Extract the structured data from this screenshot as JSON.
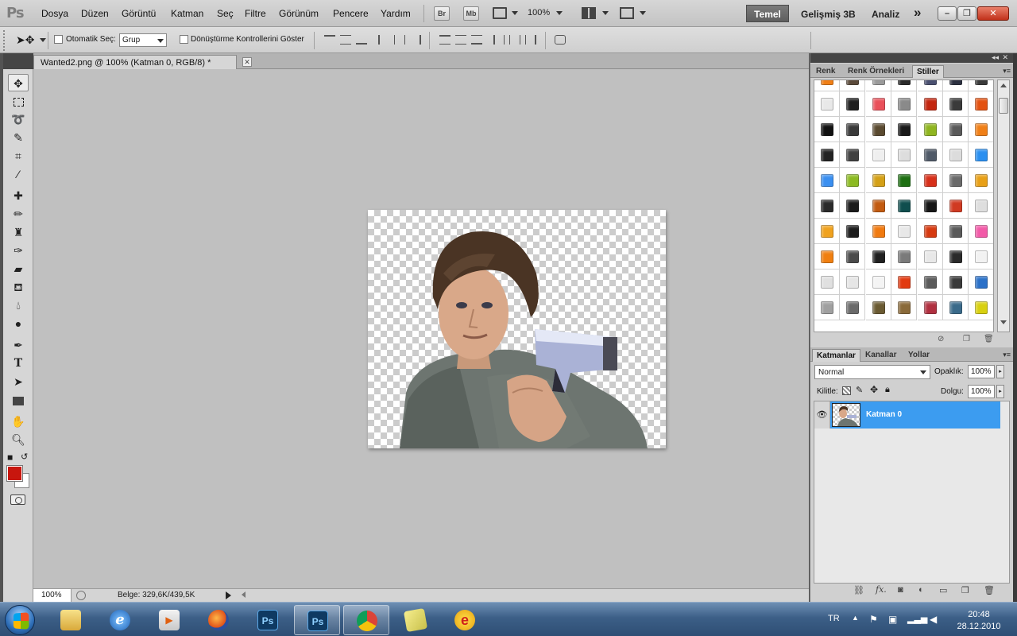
{
  "menubar": {
    "items": [
      "Dosya",
      "Düzen",
      "Görüntü",
      "Katman",
      "Seç",
      "Filtre",
      "Görünüm",
      "Pencere",
      "Yardım"
    ],
    "bridge_label": "Br",
    "minibridge_label": "Mb",
    "zoom": "100%",
    "workspace_active": "Temel",
    "workspace_items": [
      "Gelişmiş 3B",
      "Analiz"
    ],
    "more_symbol": "»"
  },
  "options": {
    "auto_select_label": "Otomatik Seç:",
    "auto_select_value": "Grup",
    "transform_label": "Dönüştürme Kontrollerini Göster"
  },
  "document": {
    "tab_title": "Wanted2.png @ 100% (Katman 0, RGB/8) *",
    "zoom": "100%",
    "info": "Belge: 329,6K/439,5K"
  },
  "styles_panel": {
    "tabs": [
      "Renk",
      "Renk Örnekleri",
      "Stiller"
    ],
    "active_tab": "Stiller",
    "swatches": [
      [
        "#f07f17",
        "#5b4a3a",
        "#9a9a9a",
        "#2a2a2a",
        "#4a5070",
        "#2c3040",
        "#3a3a3a"
      ],
      [
        "#e8e8e8",
        "#1f1f1f",
        "#e9505a",
        "#8a8a8a",
        "#c3260f",
        "#3a3a3a",
        "#e35211"
      ],
      [
        "#111111",
        "#3a3a3a",
        "#5a4a30",
        "#1a1a1a",
        "#8fb520",
        "#5a5a5a",
        "#f07f17"
      ],
      [
        "#222222",
        "#3f3f3f",
        "#efefef",
        "#dddddd",
        "#505a68",
        "#dcdcdc",
        "#2a8ff0"
      ],
      [
        "#3a8ff0",
        "#8cba22",
        "#d4a017",
        "#1e6f12",
        "#d7301a",
        "#6a6a6a",
        "#e8a017"
      ],
      [
        "#2a2a2a",
        "#1a1a1a",
        "#c25a10",
        "#0f4e4e",
        "#161616",
        "#d03a22",
        "#dedede"
      ],
      [
        "#f0a21e",
        "#1c1c1c",
        "#f07a10",
        "#e8e8e8",
        "#d63a10",
        "#5a5a5a",
        "#f25aa8"
      ],
      [
        "#f07f10",
        "#4a4a4a",
        "#202020",
        "#7a7a7a",
        "#e8e8e8",
        "#2a2a2a",
        "#f2f2f2"
      ],
      [
        "#e0e0e0",
        "#e6e6e6",
        "#f4f4f4",
        "#e23a10",
        "#5a5a5a",
        "#3a3a3a",
        "#2a70c8"
      ],
      [
        "#a0a0a0",
        "#6a6a6a",
        "#6a5a32",
        "#8a6a3a",
        "#b03040",
        "#3a6a8a",
        "#d8d010"
      ]
    ]
  },
  "layers_panel": {
    "tabs": [
      "Katmanlar",
      "Kanallar",
      "Yollar"
    ],
    "active_tab": "Katmanlar",
    "blend_mode": "Normal",
    "opacity_label": "Opaklık:",
    "opacity_value": "100%",
    "lock_label": "Kilitle:",
    "fill_label": "Dolgu:",
    "fill_value": "100%",
    "layers": [
      {
        "name": "Katman 0",
        "visible": true,
        "selected": true
      }
    ]
  },
  "taskbar": {
    "apps": [
      {
        "name": "explorer",
        "label": ""
      },
      {
        "name": "internet-explorer",
        "label": "e"
      },
      {
        "name": "media-player",
        "label": "▶"
      },
      {
        "name": "firefox",
        "label": ""
      },
      {
        "name": "photoshop-pinned",
        "label": "Ps"
      },
      {
        "name": "photoshop-open",
        "label": "Ps"
      },
      {
        "name": "chrome",
        "label": ""
      },
      {
        "name": "sticky-notes",
        "label": ""
      },
      {
        "name": "ebuddy",
        "label": "e"
      }
    ],
    "lang": "TR",
    "time": "20:48",
    "date": "28.12.2010"
  },
  "colors": {
    "foreground": "#c8160e",
    "background": "#ffffff",
    "selection": "#3c9cf0"
  }
}
